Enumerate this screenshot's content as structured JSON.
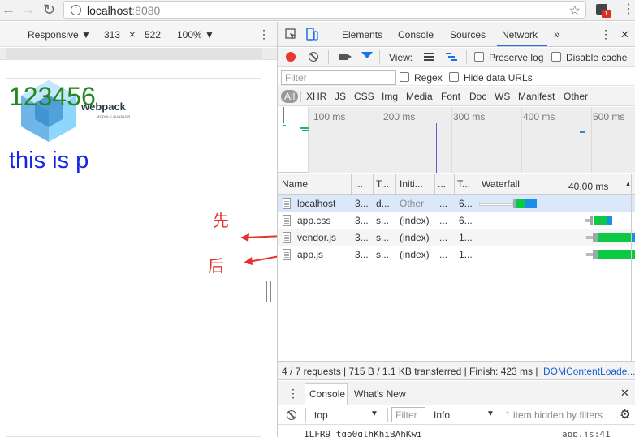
{
  "browser": {
    "url_host": "localhost",
    "url_port": ":8080",
    "ext_badge": "1",
    "nav_back": "←",
    "nav_forward": "→",
    "nav_reload": "↻",
    "star": "☆",
    "menu": "⋮"
  },
  "device_toolbar": {
    "mode": "Responsive ▼",
    "width": "313",
    "times": "×",
    "height": "522",
    "zoom": "100% ▼",
    "more": "⋮"
  },
  "page": {
    "heading": "123456",
    "paragraph": "this is p",
    "logo_title": "webpack",
    "logo_subtitle": "MODULE BUNDLER"
  },
  "annotations": {
    "first": "先",
    "second": "后",
    "color": "#e3342c"
  },
  "devtools": {
    "tabs": [
      "Elements",
      "Console",
      "Sources",
      "Network"
    ],
    "active_tab": "Network",
    "more_tabs": "»",
    "menu": "⋮",
    "close": "✕",
    "view_label": "View:",
    "preserve_log": "Preserve log",
    "disable_cache": "Disable cache",
    "filter_placeholder": "Filter",
    "regex": "Regex",
    "hide_data_urls": "Hide data URLs",
    "types": [
      "All",
      "XHR",
      "JS",
      "CSS",
      "Img",
      "Media",
      "Font",
      "Doc",
      "WS",
      "Manifest",
      "Other"
    ],
    "timeline_ticks": [
      "100 ms",
      "200 ms",
      "300 ms",
      "400 ms",
      "500 ms"
    ],
    "columns": {
      "name": "Name",
      "status": "...",
      "type": "T...",
      "initiator": "Initi...",
      "size": "...",
      "time": "T...",
      "waterfall": "Waterfall",
      "waterfall_time": "40.00 ms",
      "sort": "▲"
    },
    "requests": [
      {
        "name": "localhost",
        "status": "3...",
        "type": "d...",
        "initiator": "Other",
        "size": "...",
        "time": "6..."
      },
      {
        "name": "app.css",
        "status": "3...",
        "type": "s...",
        "initiator": "(index)",
        "size": "...",
        "time": "6..."
      },
      {
        "name": "vendor.js",
        "status": "3...",
        "type": "s...",
        "initiator": "(index)",
        "size": "...",
        "time": "1..."
      },
      {
        "name": "app.js",
        "status": "3...",
        "type": "s...",
        "initiator": "(index)",
        "size": "...",
        "time": "1..."
      }
    ],
    "status_summary": "4 / 7 requests | 715 B / 1.1 KB transferred | Finish: 423 ms |",
    "status_dcl": "DOMContentLoade...",
    "drawer": {
      "more": "⋮",
      "tabs": [
        "Console",
        "What's New"
      ],
      "close": "✕",
      "context": "top",
      "context_arrow": "▼",
      "filter_placeholder": "Filter",
      "level": "Info",
      "level_arrow": "▼",
      "hidden_msg": "1 item hidden by filters",
      "gear": "⚙",
      "log_text": "1LFR9_tgo0qlhKhiBAhKwi",
      "log_source": "app.js:41"
    }
  },
  "colors": {
    "accent_blue": "#1a73e8",
    "heading_green": "#22881f",
    "paragraph_blue": "#1424e8",
    "record_red": "#e33",
    "waterfall_green": "#0bc944",
    "waterfall_blue": "#1a8fe8",
    "selected_row": "#dbe8fa"
  }
}
